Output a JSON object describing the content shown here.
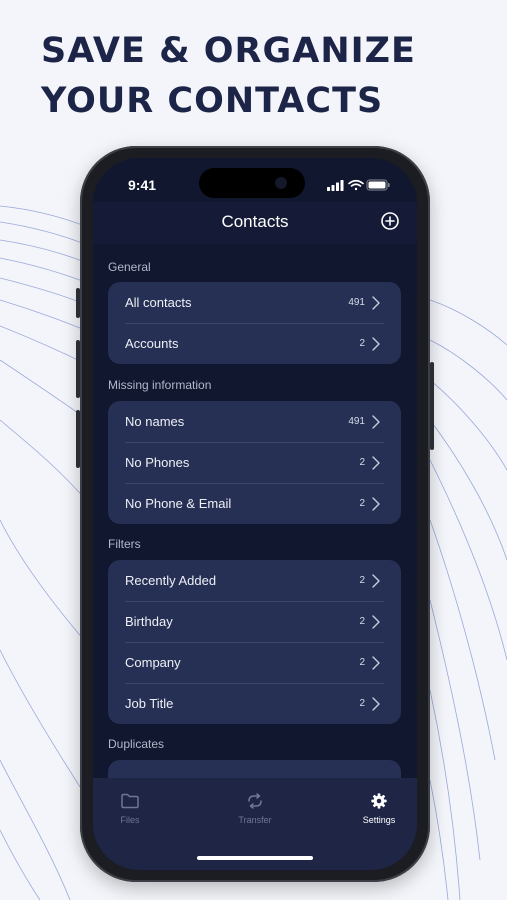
{
  "headline": {
    "line1": "SAVE & ORGANIZE",
    "line2": "YOUR CONTACTS"
  },
  "status_bar": {
    "time": "9:41"
  },
  "nav": {
    "title": "Contacts",
    "add_icon": "plus-circle-icon"
  },
  "sections": {
    "general": {
      "header": "General",
      "rows": [
        {
          "label": "All contacts",
          "count": "491"
        },
        {
          "label": "Accounts",
          "count": "2"
        }
      ]
    },
    "missing": {
      "header": "Missing information",
      "rows": [
        {
          "label": "No names",
          "count": "491"
        },
        {
          "label": "No Phones",
          "count": "2"
        },
        {
          "label": "No Phone & Email",
          "count": "2"
        }
      ]
    },
    "filters": {
      "header": "Filters",
      "rows": [
        {
          "label": "Recently Added",
          "count": "2"
        },
        {
          "label": "Birthday",
          "count": "2"
        },
        {
          "label": "Company",
          "count": "2"
        },
        {
          "label": "Job Title",
          "count": "2"
        }
      ]
    },
    "duplicates": {
      "header": "Duplicates"
    }
  },
  "tabbar": {
    "tabs": [
      {
        "label": "Files",
        "icon": "folder-icon"
      },
      {
        "label": "Transfer",
        "icon": "sync-icon"
      },
      {
        "label": "Settings",
        "icon": "gear-icon"
      }
    ],
    "active": "Settings"
  },
  "colors": {
    "background": "#f3f5fa",
    "headline": "#1c2448",
    "screen": "#10172f",
    "card": "#263055",
    "tabbar": "#1f2645",
    "decor_lines": "#7d8fcf"
  }
}
